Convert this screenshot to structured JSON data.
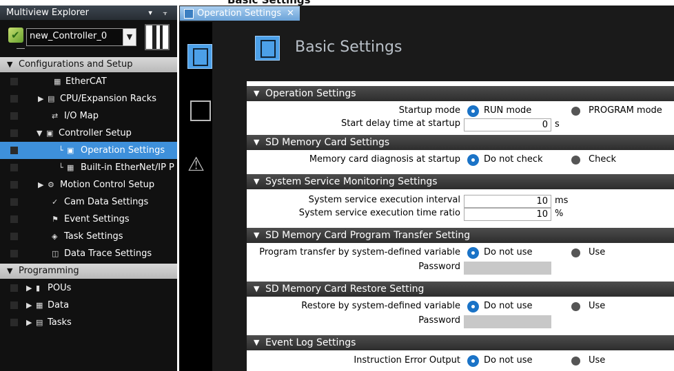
{
  "top_strip_text": "Basic Settings",
  "explorer": {
    "title": "Multiview Explorer",
    "title_buttons": "▾ ⫟",
    "controller_name": "new_Controller_0",
    "items": [
      {
        "label": "Configurations and Setup",
        "kind": "group"
      },
      {
        "label": "EtherCAT"
      },
      {
        "label": "CPU/Expansion Racks"
      },
      {
        "label": "I/O Map"
      },
      {
        "label": "Controller Setup"
      },
      {
        "label": "Operation Settings"
      },
      {
        "label": "Built-in EtherNet/IP P"
      },
      {
        "label": "Motion Control Setup"
      },
      {
        "label": "Cam Data Settings"
      },
      {
        "label": "Event Settings"
      },
      {
        "label": "Task Settings"
      },
      {
        "label": "Data Trace Settings"
      },
      {
        "label": "Programming",
        "kind": "group"
      },
      {
        "label": "POUs"
      },
      {
        "label": "Data"
      },
      {
        "label": "Tasks"
      }
    ]
  },
  "tab": {
    "label": "Operation Settings",
    "close": "✕"
  },
  "page_title": "Basic Settings",
  "sections": {
    "operation": {
      "title": "Operation Settings",
      "startup_mode_label": "Startup mode",
      "startup_mode_opt1": "RUN mode",
      "startup_mode_opt2": "PROGRAM mode",
      "start_delay_label": "Start delay time at startup",
      "start_delay_value": "0",
      "start_delay_unit": "s"
    },
    "sd_card": {
      "title": "SD Memory Card Settings",
      "diag_label": "Memory card diagnosis at startup",
      "diag_opt1": "Do not check",
      "diag_opt2": "Check"
    },
    "service": {
      "title": "System Service Monitoring Settings",
      "interval_label": "System service execution interval",
      "interval_value": "10",
      "interval_unit": "ms",
      "ratio_label": "System service execution time ratio",
      "ratio_value": "10",
      "ratio_unit": "%"
    },
    "transfer": {
      "title": "SD Memory Card Program Transfer Setting",
      "var_label": "Program transfer by system-defined variable",
      "opt1": "Do not use",
      "opt2": "Use",
      "pw_label": "Password"
    },
    "restore": {
      "title": "SD Memory Card Restore Setting",
      "var_label": "Restore by system-defined variable",
      "opt1": "Do not use",
      "opt2": "Use",
      "pw_label": "Password"
    },
    "eventlog": {
      "title": "Event Log Settings",
      "err_label": "Instruction Error Output",
      "opt1": "Do not use",
      "opt2": "Use"
    }
  }
}
